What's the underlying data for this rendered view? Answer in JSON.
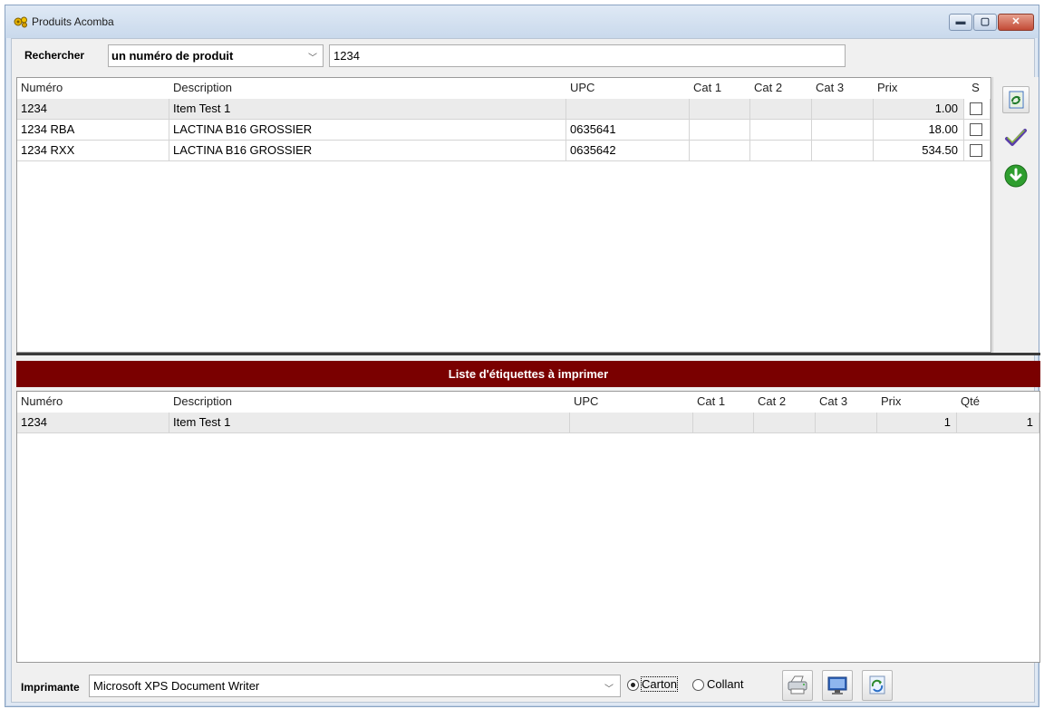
{
  "window": {
    "title": "Produits Acomba",
    "icon": "gear-icon",
    "controls": {
      "minimize": "▬",
      "maximize": "▢",
      "close": "✕"
    }
  },
  "search": {
    "label": "Rechercher",
    "mode": "un numéro de produit",
    "value": "1234"
  },
  "products": {
    "columns": [
      "Numéro",
      "Description",
      "UPC",
      "Cat 1",
      "Cat 2",
      "Cat 3",
      "Prix",
      "S"
    ],
    "rows": [
      {
        "numero": "1234",
        "description": "Item Test 1",
        "upc": "",
        "cat1": "",
        "cat2": "",
        "cat3": "",
        "prix": "1.00",
        "s": false
      },
      {
        "numero": "1234 RBA",
        "description": "LACTINA B16 GROSSIER",
        "upc": "0635641",
        "cat1": "",
        "cat2": "",
        "cat3": "",
        "prix": "18.00",
        "s": false
      },
      {
        "numero": "1234 RXX",
        "description": "LACTINA B16 GROSSIER",
        "upc": "0635642",
        "cat1": "",
        "cat2": "",
        "cat3": "",
        "prix": "534.50",
        "s": false
      }
    ]
  },
  "side_tools": [
    "refresh-excel-icon",
    "checkmark-icon",
    "download-arrow-icon"
  ],
  "labels": {
    "title": "Liste d'étiquettes à imprimer",
    "columns": [
      "Numéro",
      "Description",
      "UPC",
      "Cat 1",
      "Cat 2",
      "Cat 3",
      "Prix",
      "Qté"
    ],
    "rows": [
      {
        "numero": "1234",
        "description": "Item Test 1",
        "upc": "",
        "cat1": "",
        "cat2": "",
        "cat3": "",
        "prix": "1",
        "qte": "1"
      }
    ]
  },
  "printer": {
    "label": "Imprimante",
    "value": "Microsoft XPS Document Writer",
    "options": [
      {
        "label": "Carton",
        "selected": true
      },
      {
        "label": "Collant",
        "selected": false
      }
    ],
    "buttons": [
      "printer-icon",
      "preview-icon",
      "refresh-icon"
    ]
  },
  "colors": {
    "banner": "#7a0000",
    "row_shade": "#ebebeb"
  }
}
